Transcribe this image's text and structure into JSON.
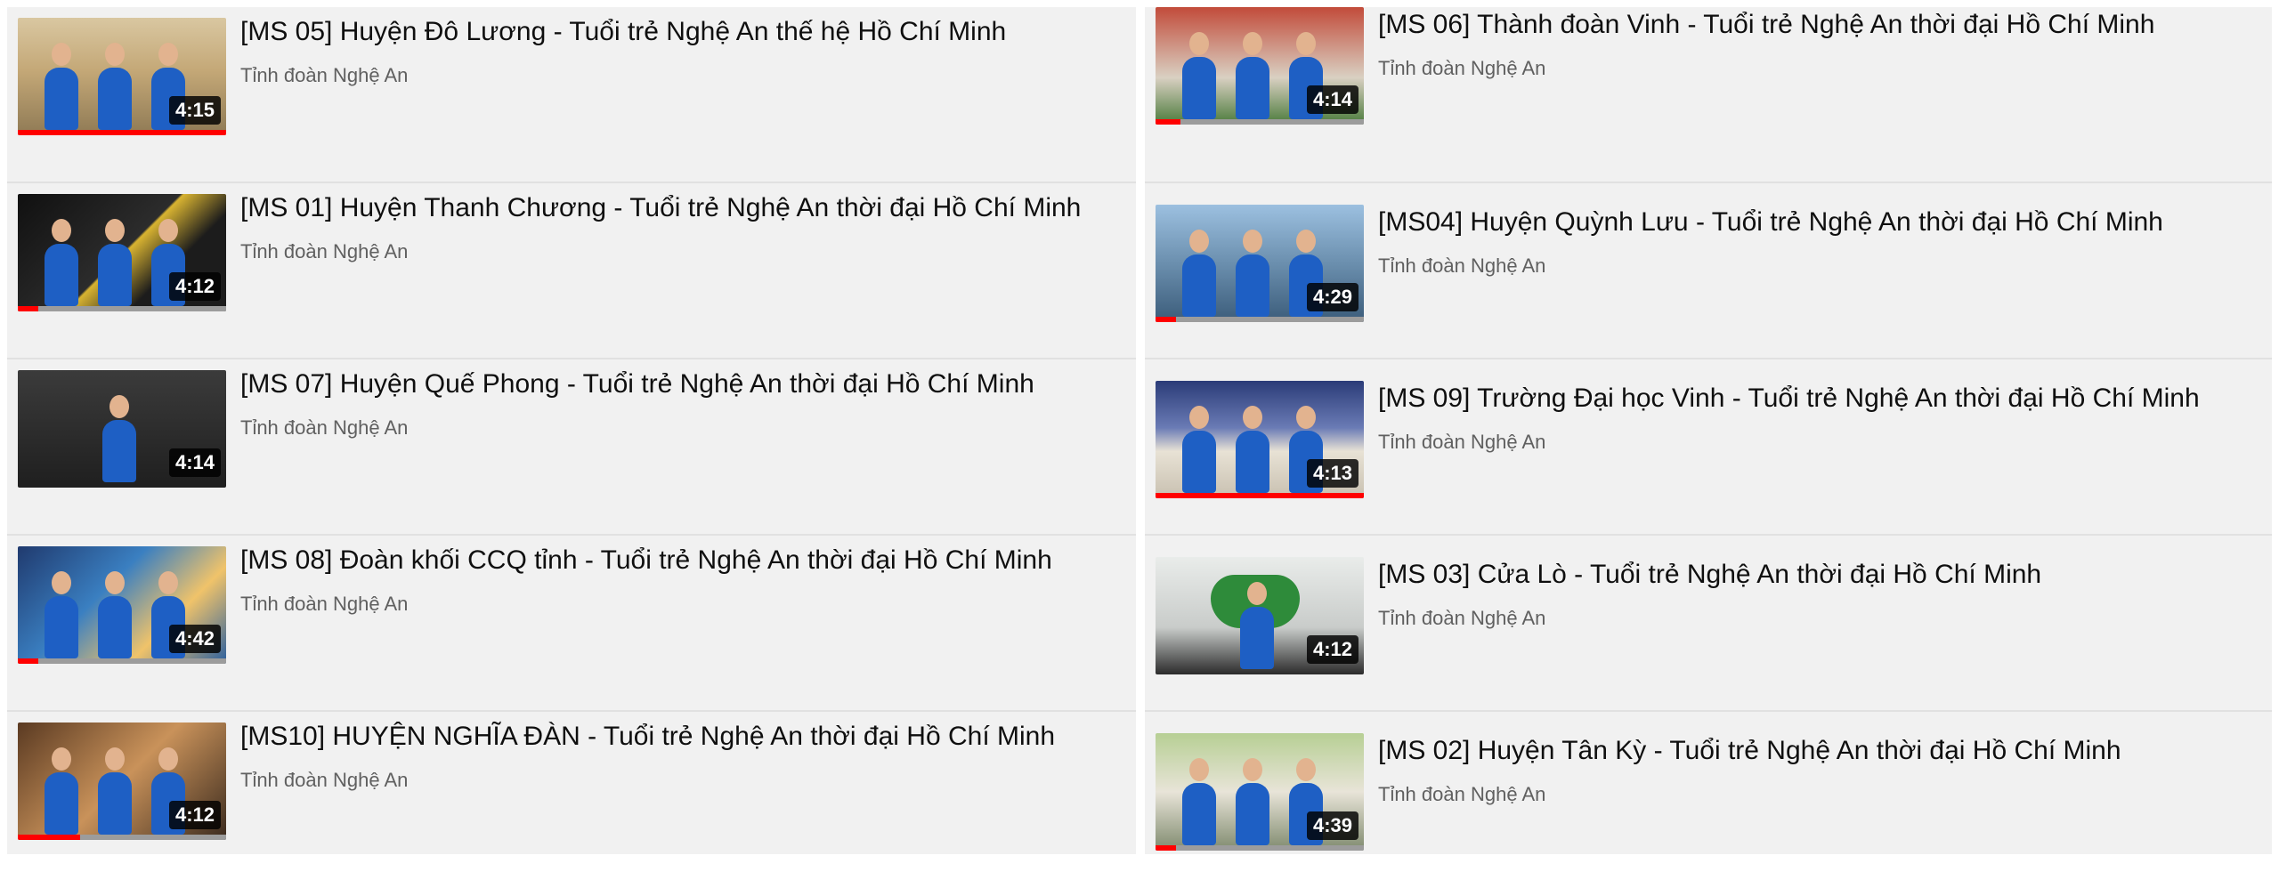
{
  "left_list": [
    {
      "title": "[MS 05] Huyện Đô Lương - Tuổi trẻ Nghệ An thế hệ Hồ Chí Minh",
      "channel": "Tỉnh đoàn Nghệ An",
      "duration": "4:15",
      "progress": 1.0,
      "scene": "outdoor",
      "accent": "#8fb0d8"
    },
    {
      "title": "[MS 01] Huyện Thanh Chương - Tuổi trẻ Nghệ An thời đại Hồ Chí Minh",
      "channel": "Tỉnh đoàn Nghệ An",
      "duration": "4:12",
      "progress": 0.1,
      "scene": "studio",
      "accent": "#e7c243"
    },
    {
      "title": "[MS 07] Huyện Quế Phong - Tuổi trẻ Nghệ An thời đại Hồ Chí Minh",
      "channel": "Tỉnh đoàn Nghệ An",
      "duration": "4:14",
      "progress": 0.0,
      "scene": "studio-dark",
      "accent": "#3a3a3a"
    },
    {
      "title": "[MS 08] Đoàn khối CCQ tỉnh - Tuổi trẻ Nghệ An thời đại Hồ Chí Minh",
      "channel": "Tỉnh đoàn Nghệ An",
      "duration": "4:42",
      "progress": 0.1,
      "scene": "stage",
      "accent": "#4aa3d6"
    },
    {
      "title": "[MS10] HUYỆN NGHĨA ĐÀN - Tuổi trẻ Nghệ An thời đại Hồ Chí Minh",
      "channel": "Tỉnh đoàn Nghệ An",
      "duration": "4:12",
      "progress": 0.3,
      "scene": "studio-warm",
      "accent": "#c98b55"
    }
  ],
  "right_list": [
    {
      "title": "[MS 06] Thành đoàn Vinh - Tuổi trẻ Nghệ An thời đại Hồ Chí Minh",
      "channel": "Tỉnh đoàn Nghệ An",
      "duration": "4:14",
      "progress": 0.12,
      "scene": "outdoor-red",
      "accent": "#b94a3a"
    },
    {
      "title": "[MS04] Huyện Quỳnh Lưu - Tuổi trẻ Nghệ An thời đại Hồ Chí Minh",
      "channel": "Tỉnh đoàn Nghệ An",
      "duration": "4:29",
      "progress": 0.1,
      "scene": "harbor",
      "accent": "#7aa5c9"
    },
    {
      "title": "[MS 09] Trường Đại học Vinh - Tuổi trẻ Nghệ An thời đại Hồ Chí Minh",
      "channel": "Tỉnh đoàn Nghệ An",
      "duration": "4:13",
      "progress": 1.0,
      "scene": "mural",
      "accent": "#3a4f8a"
    },
    {
      "title": "[MS 03] Cửa Lò - Tuổi trẻ Nghệ An thời đại Hồ Chí Minh",
      "channel": "Tỉnh đoàn Nghệ An",
      "duration": "4:12",
      "progress": 0.0,
      "scene": "heart",
      "accent": "#2e8b3a"
    },
    {
      "title": "[MS 02] Huyện Tân Kỳ - Tuổi trẻ Nghệ An thời đại Hồ Chí Minh",
      "channel": "Tỉnh đoàn Nghệ An",
      "duration": "4:39",
      "progress": 0.1,
      "scene": "outdoor-green",
      "accent": "#8aa56b"
    }
  ]
}
